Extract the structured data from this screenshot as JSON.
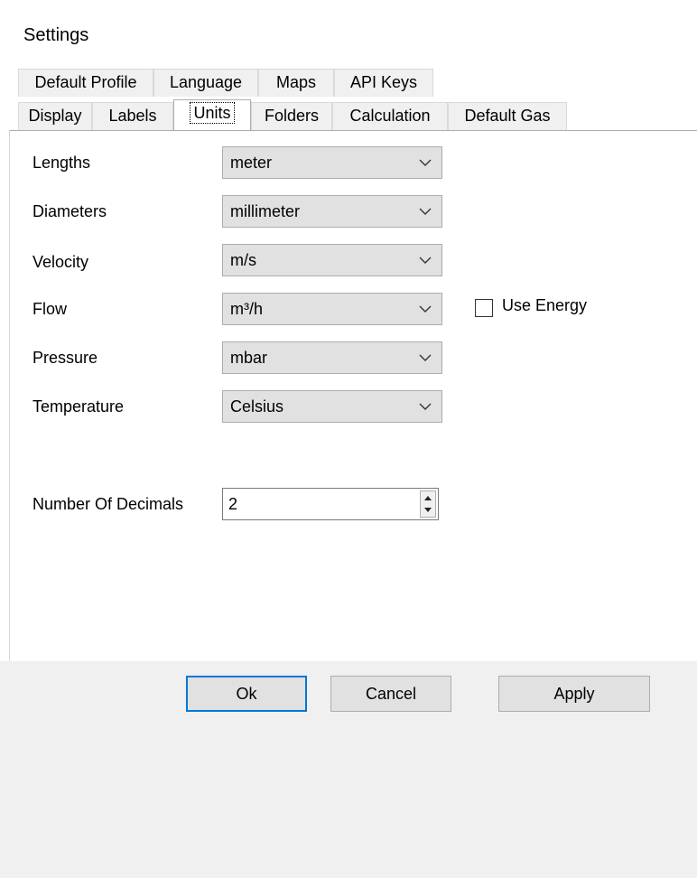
{
  "window": {
    "title": "Settings"
  },
  "tabs": {
    "row1": [
      "Default Profile",
      "Language",
      "Maps",
      "API Keys"
    ],
    "row2": [
      "Display",
      "Labels",
      "Units",
      "Folders",
      "Calculation",
      "Default Gas"
    ],
    "active": "Units"
  },
  "units": {
    "lengths": {
      "label": "Lengths",
      "value": "meter"
    },
    "diameters": {
      "label": "Diameters",
      "value": "millimeter"
    },
    "velocity": {
      "label": "Velocity",
      "value": "m/s"
    },
    "flow": {
      "label": "Flow",
      "value": "m³/h"
    },
    "pressure": {
      "label": "Pressure",
      "value": "mbar"
    },
    "temperature": {
      "label": "Temperature",
      "value": "Celsius"
    }
  },
  "use_energy": {
    "label": "Use Energy",
    "checked": false
  },
  "decimals": {
    "label": "Number Of Decimals",
    "value": "2"
  },
  "buttons": {
    "ok": "Ok",
    "cancel": "Cancel",
    "apply": "Apply"
  }
}
